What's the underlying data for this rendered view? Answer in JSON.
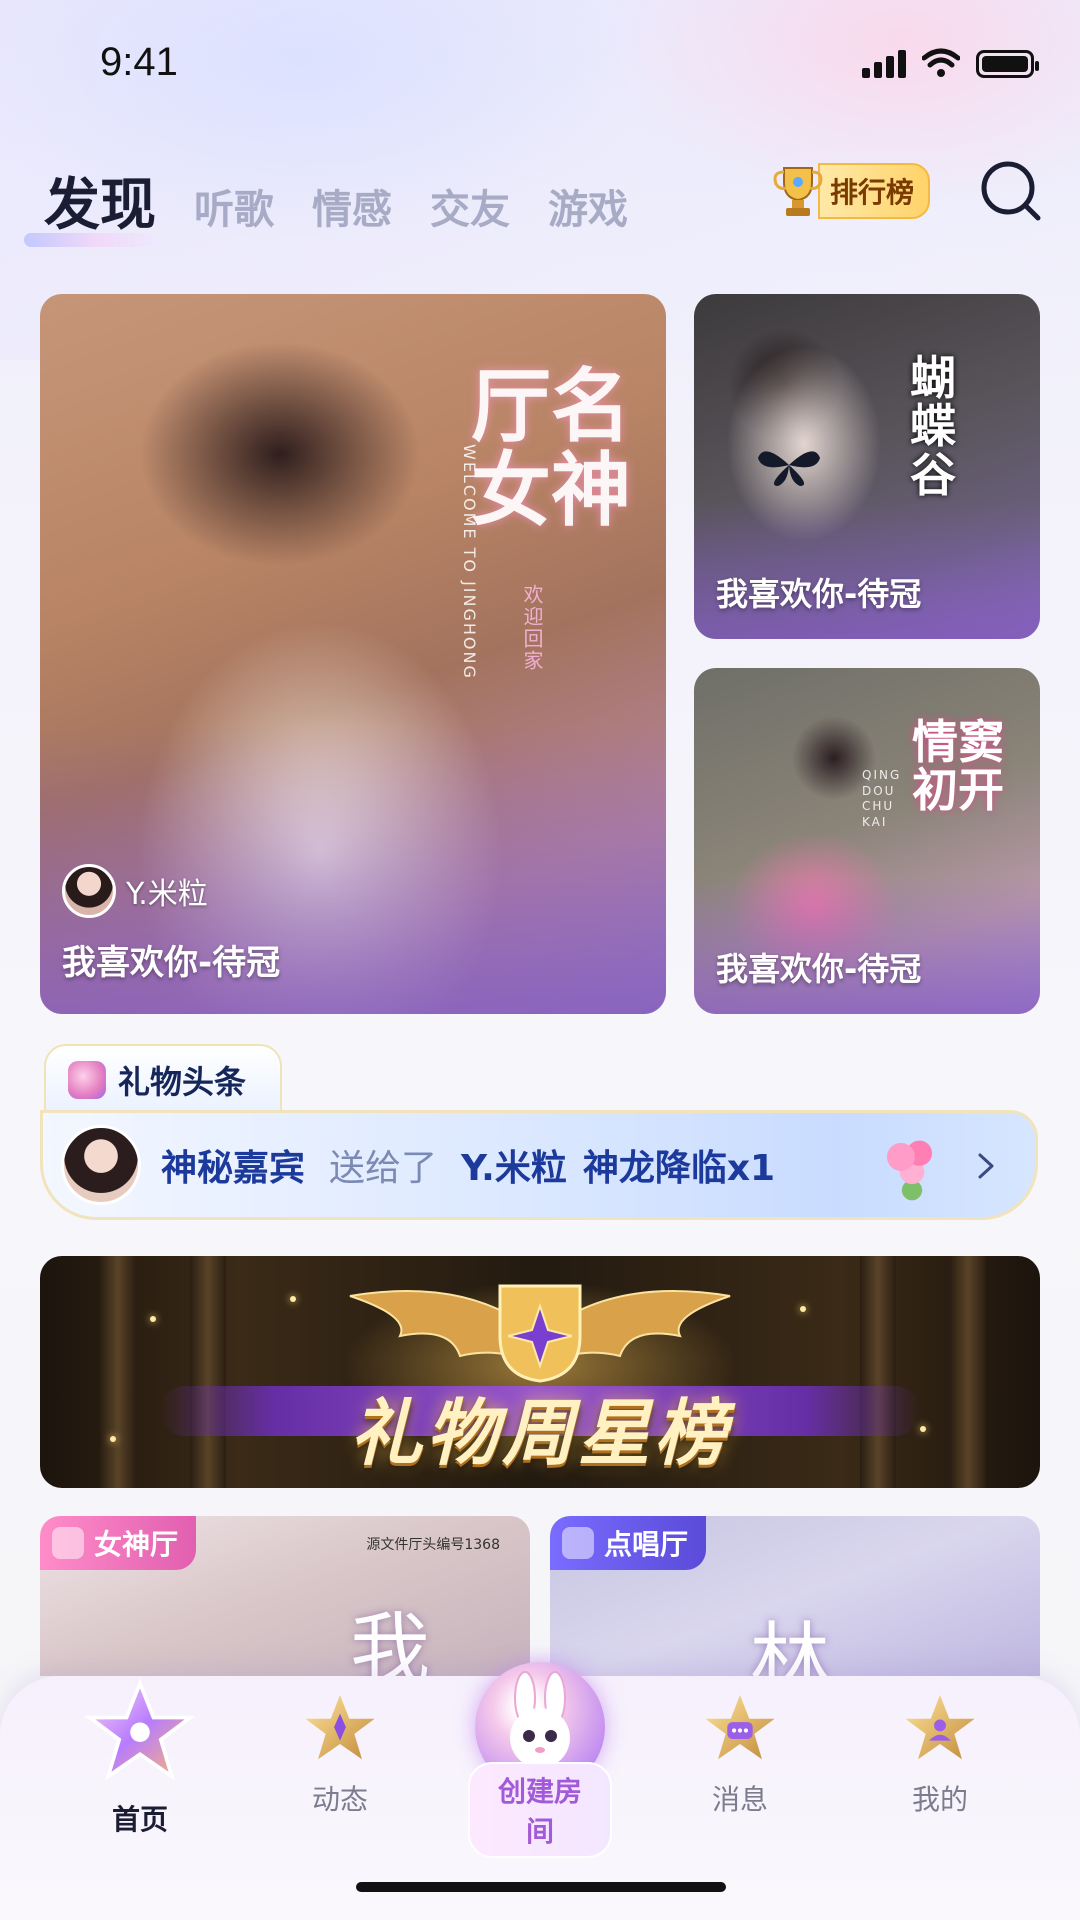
{
  "status_bar": {
    "time": "9:41"
  },
  "top_nav": {
    "tabs": [
      {
        "label": "发现",
        "active": true
      },
      {
        "label": "听歌",
        "active": false
      },
      {
        "label": "情感",
        "active": false
      },
      {
        "label": "交友",
        "active": false
      },
      {
        "label": "游戏",
        "active": false
      }
    ],
    "rank_label": "排行榜"
  },
  "featured": {
    "main": {
      "poster_text": "厅名女神",
      "poster_sub": "WELCOME TO JINGHONG",
      "poster_tag": "欢迎回家",
      "owner_name": "Y.米粒",
      "title": "我喜欢你-待冠"
    },
    "side_1": {
      "poster_text": "蝴蝶谷",
      "title": "我喜欢你-待冠"
    },
    "side_2": {
      "poster_text": "情窦初开",
      "poster_sub": "QING DOU CHU KAI",
      "title": "我喜欢你-待冠"
    }
  },
  "gift_headline": {
    "tab_label": "礼物头条",
    "sender": "神秘嘉宾",
    "verb": "送给了",
    "receiver": "Y.米粒",
    "item": "神龙降临x1"
  },
  "banner": {
    "title": "礼物周星榜"
  },
  "rooms": [
    {
      "tag": "女神厅",
      "caption": "源文件厅头编号1368",
      "glyph": "我"
    },
    {
      "tag": "点唱厅",
      "glyph": "林"
    }
  ],
  "tab_bar": {
    "items": [
      {
        "label": "首页",
        "active": true
      },
      {
        "label": "动态",
        "active": false
      },
      {
        "label": "创建房间",
        "active": false
      },
      {
        "label": "消息",
        "active": false
      },
      {
        "label": "我的",
        "active": false
      }
    ]
  },
  "colors": {
    "active_text": "#1a1d33",
    "inactive_tab": "#a7abc6",
    "gift_blue": "#1c3a9c",
    "create_accent": "#a25bd8"
  },
  "icons": [
    "signal-icon",
    "wifi-icon",
    "battery-icon",
    "trophy-icon",
    "search-icon",
    "gift-icon",
    "flower-bouquet-icon",
    "chevron-right-icon",
    "star-home-icon",
    "star-moments-icon",
    "bunny-create-icon",
    "star-messages-icon",
    "star-profile-icon"
  ]
}
